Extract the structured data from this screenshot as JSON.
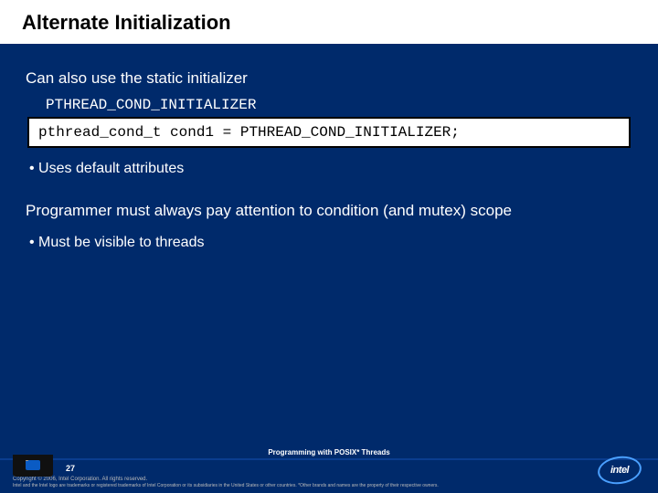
{
  "title": "Alternate Initialization",
  "intro": "Can also use the static initializer",
  "macro": "PTHREAD_COND_INITIALIZER",
  "code": "pthread_cond_t cond1 = PTHREAD_COND_INITIALIZER;",
  "bullet1": "• Uses default attributes",
  "para2": "Programmer must always pay attention to condition (and mutex) scope",
  "bullet2": "• Must be visible to threads",
  "footer": {
    "course": "Programming with POSIX* Threads",
    "pagenum": "27",
    "copyright": "Copyright © 2006, Intel Corporation. All rights reserved.",
    "legal": "Intel and the Intel logo are trademarks or registered trademarks of Intel Corporation or its subsidiaries in the United States or other countries. *Other brands and names are the property of their respective owners.",
    "logo": "intel"
  }
}
